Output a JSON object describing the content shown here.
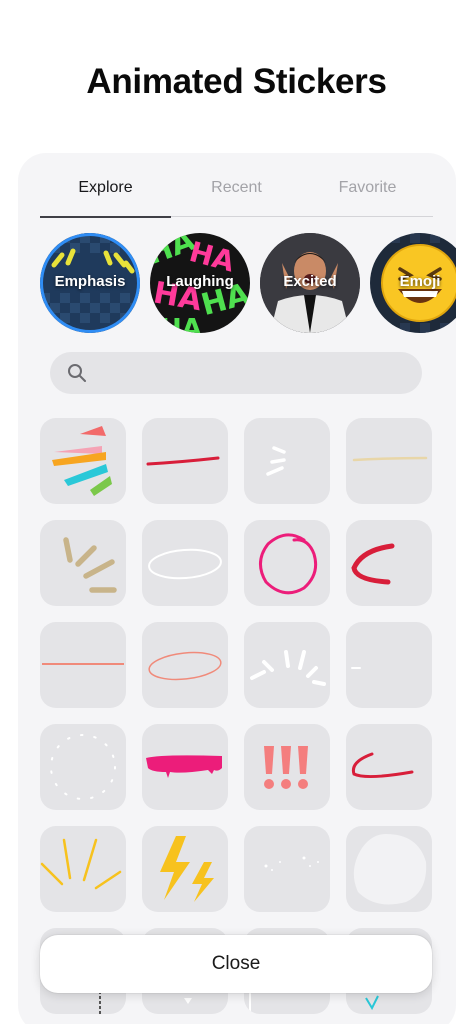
{
  "header": {
    "title": "Animated Stickers"
  },
  "tabs": [
    {
      "label": "Explore",
      "active": true
    },
    {
      "label": "Recent",
      "active": false
    },
    {
      "label": "Favorite",
      "active": false
    }
  ],
  "categories": [
    {
      "label": "Emphasis",
      "selected": true
    },
    {
      "label": "Laughing",
      "selected": false
    },
    {
      "label": "Excited",
      "selected": false
    },
    {
      "label": "Emoji",
      "selected": false
    }
  ],
  "search": {
    "placeholder": "",
    "value": "",
    "icon": "search-icon"
  },
  "stickers": [
    "fan-burst-sticker",
    "red-line-sticker",
    "white-dashes-sticker",
    "beige-line-sticker",
    "beige-burst-sticker",
    "white-oval-sticker",
    "pink-circle-sticker",
    "red-arc-sticker",
    "salmon-line-sticker",
    "salmon-oval-sticker",
    "white-burst-sticker",
    "small-dash-sticker",
    "dotted-circle-sticker",
    "pink-paint-sticker",
    "exclamation-sticker",
    "red-swoosh-sticker",
    "yellow-burst-sticker",
    "lightning-sticker",
    "sparkle-dots-sticker",
    "white-blob-sticker"
  ],
  "colors": {
    "accent": "#2f8df5",
    "sheet": "#f5f5f7",
    "tile": "#e4e4e7",
    "pink": "#ec1d7a",
    "red": "#d81e3a",
    "salmon": "#f08a7a",
    "yellow": "#f7c21e"
  },
  "footer": {
    "close_label": "Close"
  }
}
